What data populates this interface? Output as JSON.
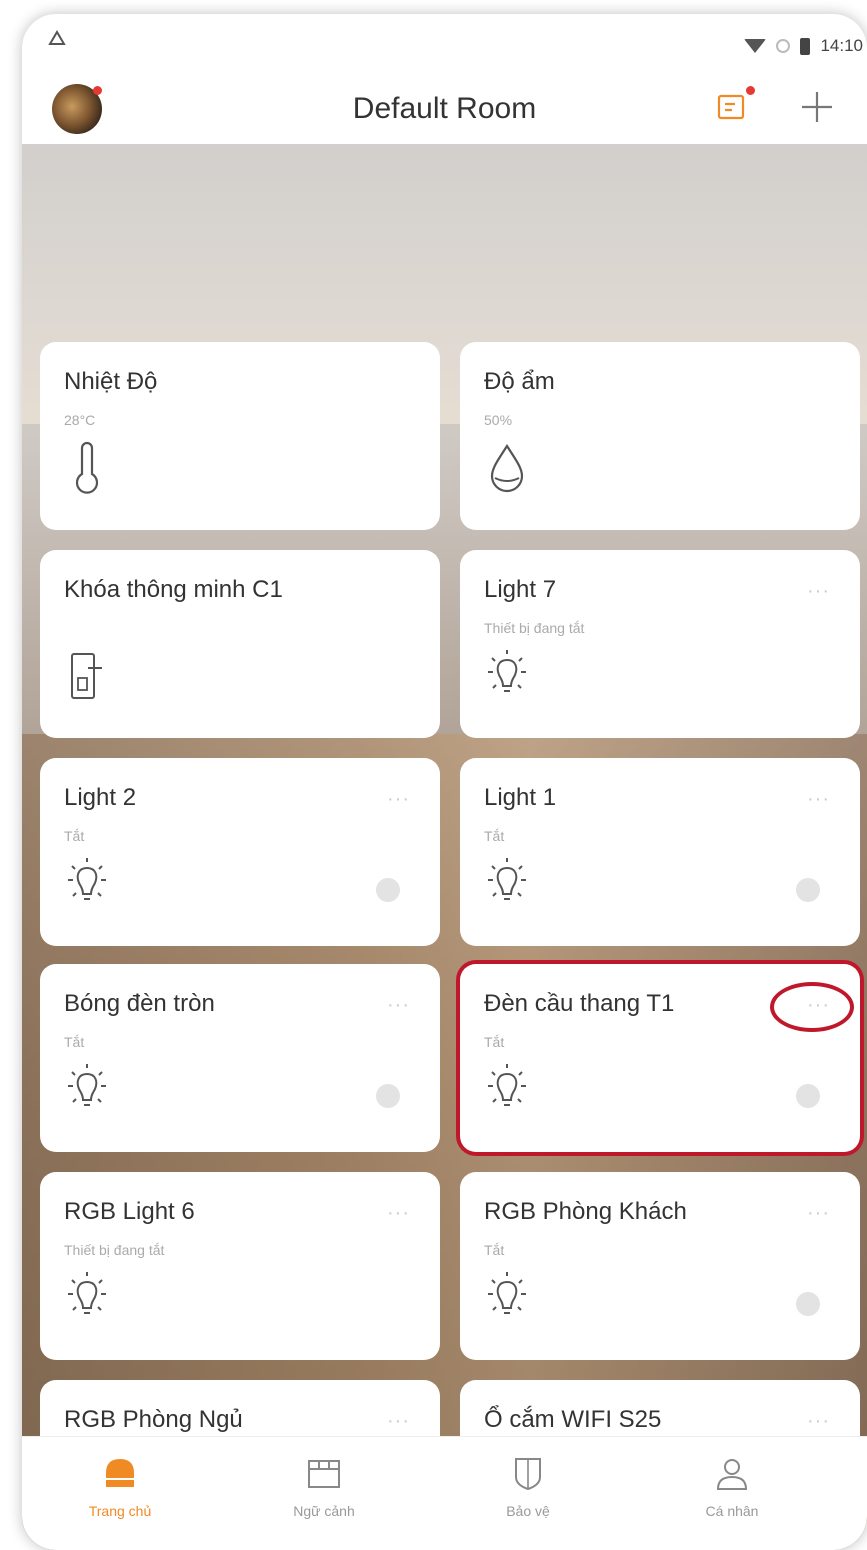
{
  "status_bar": {
    "carrier_icon": "android-alert-icon",
    "time": "14:10"
  },
  "header": {
    "title": "Default Room",
    "icons": [
      "avatar",
      "message-icon",
      "add-icon"
    ]
  },
  "devices": [
    {
      "name": "Nhiệt Độ",
      "status": "28°C",
      "icon": "thermometer-icon",
      "has_menu": false,
      "has_toggle": false
    },
    {
      "name": "Độ ẩm",
      "status": "50%",
      "icon": "water-drop-icon",
      "has_menu": false,
      "has_toggle": false
    },
    {
      "name": "Khóa thông minh C1",
      "status": "",
      "icon": "smart-lock-icon",
      "has_menu": false,
      "has_toggle": false
    },
    {
      "name": "Light 7",
      "status": "Thiết bị đang tắt",
      "icon": "bulb-icon",
      "has_menu": true,
      "has_toggle": false
    },
    {
      "name": "Light 2",
      "status": "Tắt",
      "icon": "bulb-icon",
      "has_menu": true,
      "has_toggle": true
    },
    {
      "name": "Light 1",
      "status": "Tắt",
      "icon": "bulb-icon",
      "has_menu": true,
      "has_toggle": true
    },
    {
      "name": "Bóng đèn tròn",
      "status": "Tắt",
      "icon": "bulb-icon",
      "has_menu": true,
      "has_toggle": true
    },
    {
      "name": "Đèn cầu thang T1",
      "status": "Tắt",
      "icon": "bulb-icon",
      "has_menu": true,
      "has_toggle": true,
      "highlighted": true
    },
    {
      "name": "RGB Light 6",
      "status": "Thiết bị đang tắt",
      "icon": "bulb-icon",
      "has_menu": true,
      "has_toggle": false
    },
    {
      "name": "RGB Phòng Khách",
      "status": "Tắt",
      "icon": "bulb-icon",
      "has_menu": true,
      "has_toggle": true
    },
    {
      "name": "RGB Phòng Ngủ",
      "status": "",
      "icon": "bulb-icon",
      "has_menu": true,
      "has_toggle": false
    },
    {
      "name": "Ổ cắm WIFI S25",
      "status": "",
      "icon": "socket-icon",
      "has_menu": true,
      "has_toggle": false
    }
  ],
  "more_glyph": "···",
  "tabs": [
    {
      "label": "Trang chủ",
      "icon": "home-icon",
      "active": true
    },
    {
      "label": "Ngữ cảnh",
      "icon": "scene-icon",
      "active": false
    },
    {
      "label": "Bảo vệ",
      "icon": "shield-icon",
      "active": false
    },
    {
      "label": "Cá nhân",
      "icon": "person-icon",
      "active": false
    }
  ],
  "colors": {
    "accent": "#f08a24",
    "highlight": "#c0182b",
    "card": "#ffffff"
  }
}
